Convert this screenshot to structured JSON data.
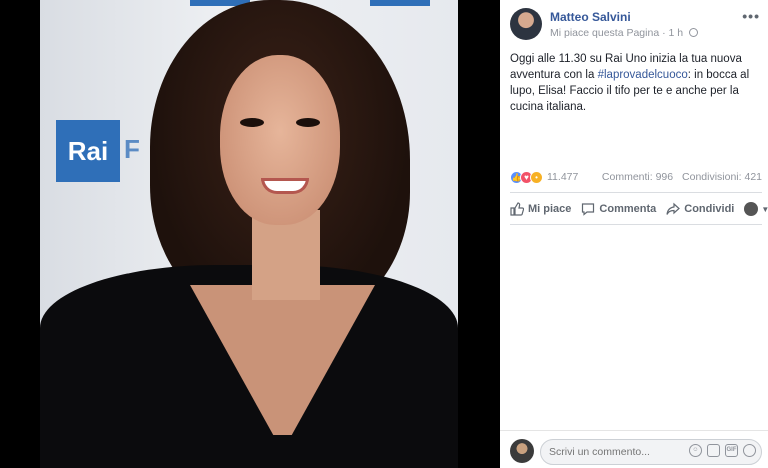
{
  "post": {
    "author": "Matteo Salvini",
    "page_like": "Mi piace questa Pagina",
    "separator": "·",
    "time": "1 h",
    "more_label": "•••",
    "text_before": "Oggi alle 11.30 su Rai Uno inizia la tua nuova avventura con la ",
    "hashtag": "#laprovadelcuoco",
    "text_after": ": in bocca al lupo, Elisa! Faccio il tifo per te e anche per la cucina italiana."
  },
  "photo": {
    "logo_text": "Rai",
    "logo_suffix": "F"
  },
  "reactions": {
    "count": "11.477",
    "comments": "Commenti: 996",
    "shares": "Condivisioni: 421"
  },
  "actions": {
    "like": "Mi piace",
    "comment": "Commenta",
    "share": "Condividi"
  },
  "comment_box": {
    "placeholder": "Scrivi un commento..."
  },
  "icons": {
    "emoji": "emoji-icon",
    "camera": "camera-icon",
    "gif": "gif-icon",
    "sticker": "sticker-icon"
  },
  "colors": {
    "link": "#365899",
    "muted": "#90949c",
    "like_reaction": "#5890ff",
    "love_reaction": "#f25268",
    "wow_reaction": "#f7b125"
  }
}
